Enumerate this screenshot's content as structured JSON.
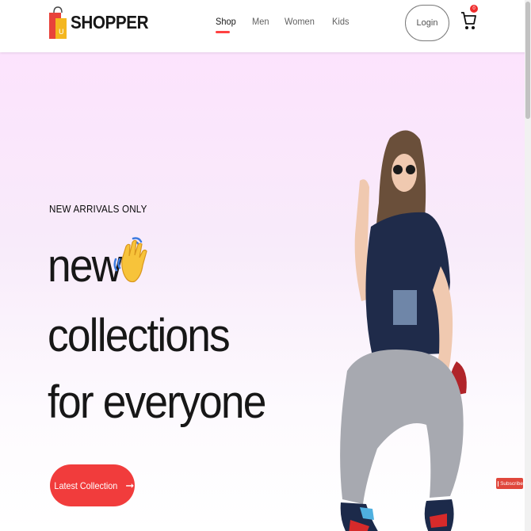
{
  "brand": {
    "name": "SHOPPER"
  },
  "nav": {
    "items": [
      {
        "label": "Shop",
        "active": true
      },
      {
        "label": "Men",
        "active": false
      },
      {
        "label": "Women",
        "active": false
      },
      {
        "label": "Kids",
        "active": false
      }
    ]
  },
  "header": {
    "login_label": "Login",
    "cart_count": "0",
    "cart_icon": "cart-icon"
  },
  "hero": {
    "eyebrow": "NEW ARRIVALS ONLY",
    "line1": "new",
    "line2": "collections",
    "line3": "for everyone",
    "hand_icon": "waving-hand-icon",
    "cta_label": "Latest Collection",
    "cta_arrow": "➞"
  },
  "subscribe": {
    "label": "Subscribe"
  },
  "colors": {
    "accent": "#ff4141",
    "cta": "#f13c3c",
    "hero_top": "#fce3fd",
    "text": "#171717"
  }
}
